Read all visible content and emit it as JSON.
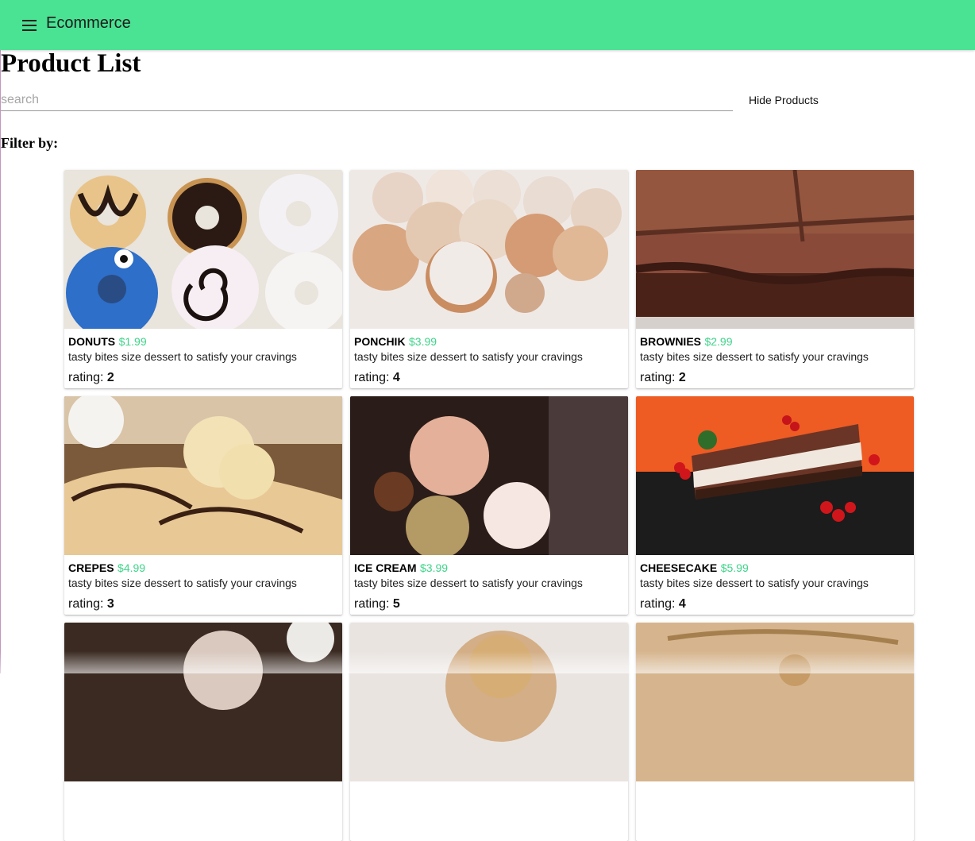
{
  "appbar": {
    "title": "Ecommerce",
    "menu_icon": "menu-icon",
    "color": "#4ae293"
  },
  "page": {
    "title": "Product List",
    "filter_label": "Filter by:"
  },
  "search": {
    "placeholder": "search",
    "value": ""
  },
  "toolbar": {
    "hide_products_label": "Hide Products"
  },
  "accent_price_color": "#3fd48a",
  "rating_label": "rating:",
  "products": [
    {
      "name": "DONUTS",
      "price": "$1.99",
      "description": "tasty bites size dessert to satisfy your cravings",
      "rating": "2",
      "image": "donuts"
    },
    {
      "name": "PONCHIK",
      "price": "$3.99",
      "description": "tasty bites size dessert to satisfy your cravings",
      "rating": "4",
      "image": "ponchik"
    },
    {
      "name": "BROWNIES",
      "price": "$2.99",
      "description": "tasty bites size dessert to satisfy your cravings",
      "rating": "2",
      "image": "brownies"
    },
    {
      "name": "CREPES",
      "price": "$4.99",
      "description": "tasty bites size dessert to satisfy your cravings",
      "rating": "3",
      "image": "crepes"
    },
    {
      "name": "ICE CREAM",
      "price": "$3.99",
      "description": "tasty bites size dessert to satisfy your cravings",
      "rating": "5",
      "image": "ice-cream"
    },
    {
      "name": "CHEESECAKE",
      "price": "$5.99",
      "description": "tasty bites size dessert to satisfy your cravings",
      "rating": "4",
      "image": "cheesecake"
    },
    {
      "image": "dessert-7"
    },
    {
      "image": "dessert-8"
    },
    {
      "image": "dessert-9"
    }
  ]
}
